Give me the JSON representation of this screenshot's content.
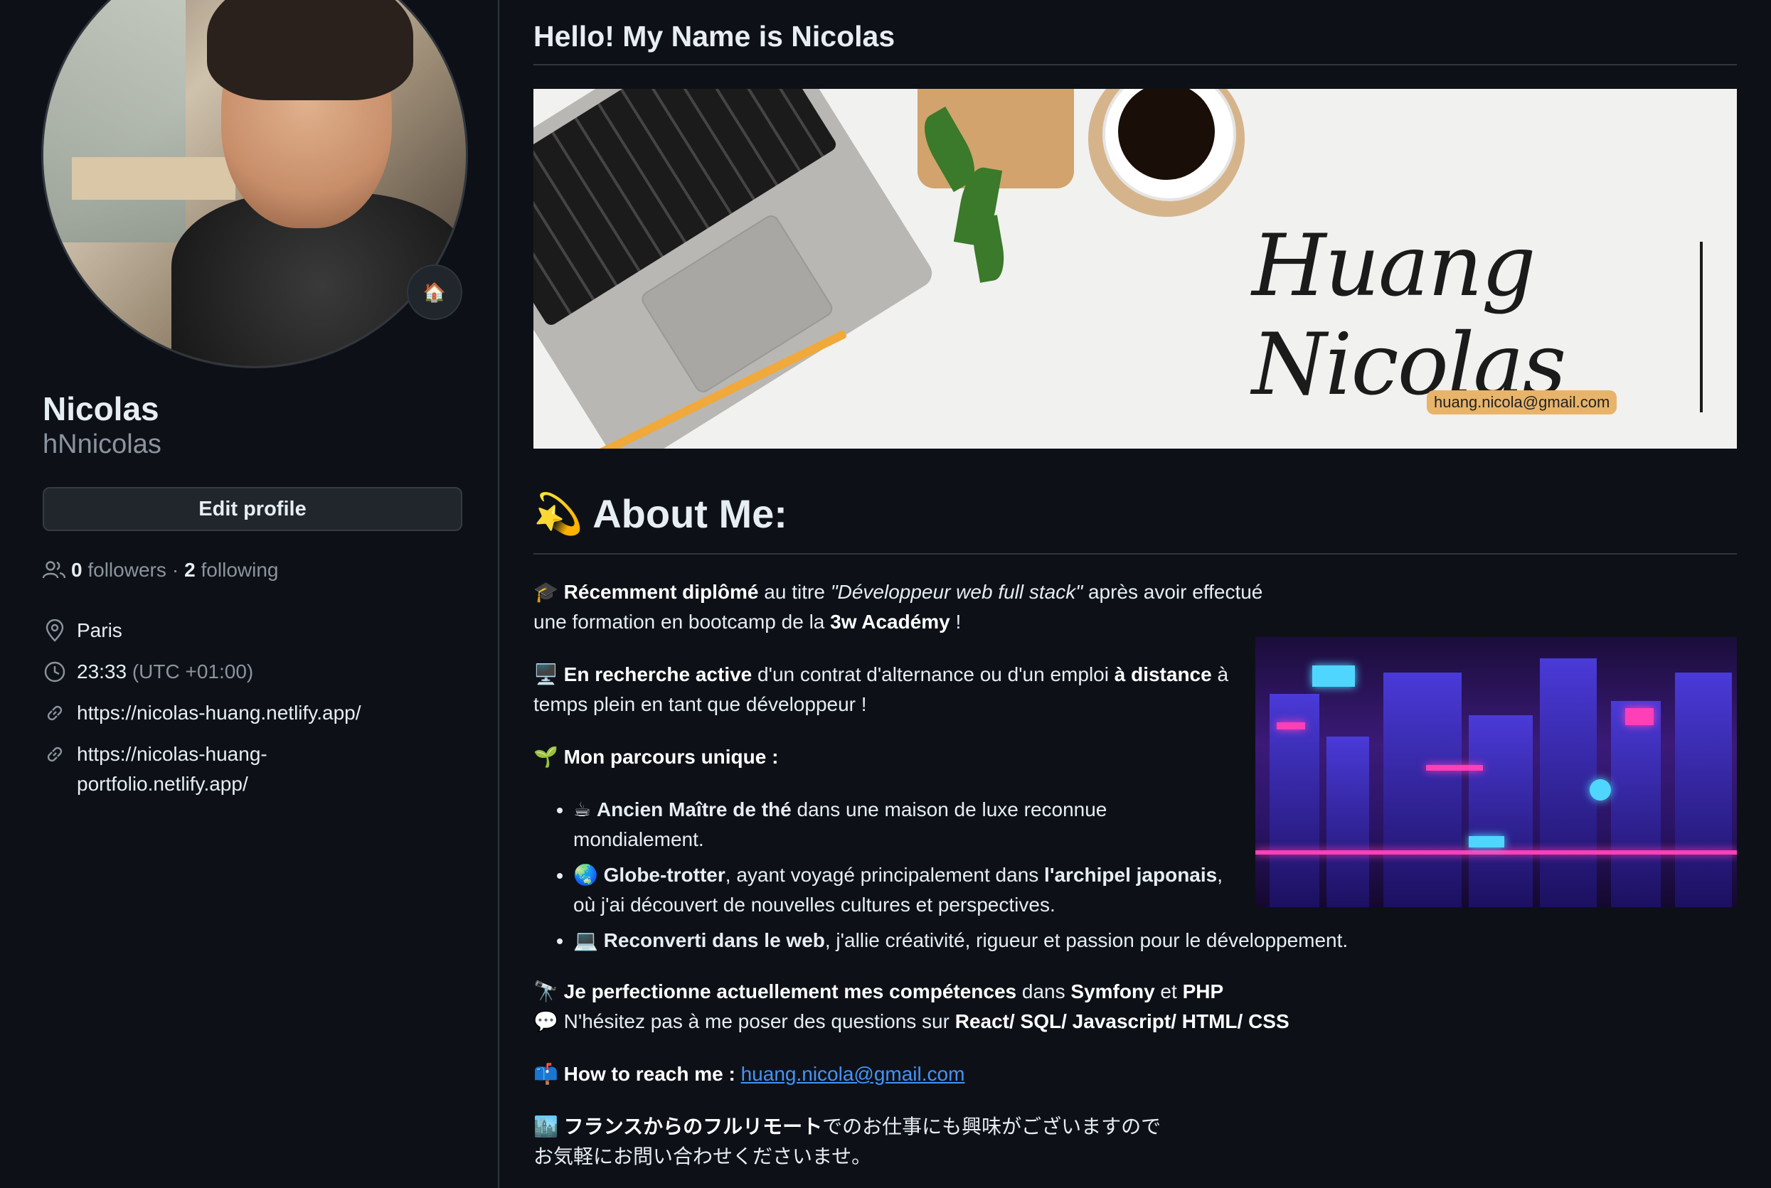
{
  "profile": {
    "display_name": "Nicolas",
    "username": "hNnicolas",
    "edit_label": "Edit profile",
    "followers_count": "0",
    "followers_label": "followers",
    "dot": "·",
    "following_count": "2",
    "following_label": "following",
    "location": "Paris",
    "time": "23:33",
    "timezone": "(UTC +01:00)",
    "link1": "https://nicolas-huang.netlify.app/",
    "link2_line1": "https://nicolas-huang-",
    "link2_line2": "portfolio.netlify.app/",
    "status_emoji": "🏠"
  },
  "readme": {
    "title": "Hello! My Name is Nicolas",
    "banner": {
      "signature": "Huang Nicolas",
      "email": "huang.nicola@gmail.com"
    },
    "about_emoji": "💫",
    "about_heading": "About Me:",
    "p1": {
      "emoji": "🎓",
      "b1": "Récemment diplômé",
      "t1": " au titre ",
      "i1": "\"Développeur web full stack\"",
      "t2": " après avoir effectué",
      "line2": "une formation en bootcamp de la ",
      "b2": "3w Académy",
      "t3": " !"
    },
    "p2": {
      "emoji": "🖥️",
      "b1": "En recherche active",
      "t1": " d'un contrat d'alternance ou d'un emploi ",
      "b2": "à distance",
      "t2": " à",
      "line2": "temps plein en tant que développeur !"
    },
    "p3": {
      "emoji": "🌱",
      "b1": "Mon parcours unique :"
    },
    "list": [
      {
        "emoji": "☕",
        "bold": "Ancien Maître de thé",
        "text": " dans une maison de luxe reconnue",
        "line2": "mondialement."
      },
      {
        "emoji": "🌏",
        "bold": "Globe-trotter",
        "text": ", ayant voyagé principalement dans ",
        "bold2": "l'archipel japonais",
        "text2": ",",
        "line2": "où j'ai découvert de nouvelles cultures et perspectives."
      },
      {
        "emoji": "💻",
        "bold": "Reconverti dans le web",
        "text": ", j'allie créativité, rigueur et passion pour le développement."
      }
    ],
    "p4": {
      "emoji": "🔭",
      "b1": "Je perfectionne actuellement mes compétences",
      "t1": " dans ",
      "b2": "Symfony",
      "t2": " et ",
      "b3": "PHP"
    },
    "p5": {
      "emoji": "💬",
      "t1": " N'hésitez pas à me poser des questions sur ",
      "b1": "React/ SQL/ Javascript/ HTML/ CSS"
    },
    "p6": {
      "emoji": "📫",
      "b1": "How to reach me :",
      "link": "huang.nicola@gmail.com"
    },
    "p7": {
      "emoji": "🏙️",
      "b1": "フランスからのフルリモート",
      "t1": "でのお仕事にも興味がございますので",
      "line2": "お気軽にお問い合わせくださいませ。"
    }
  }
}
